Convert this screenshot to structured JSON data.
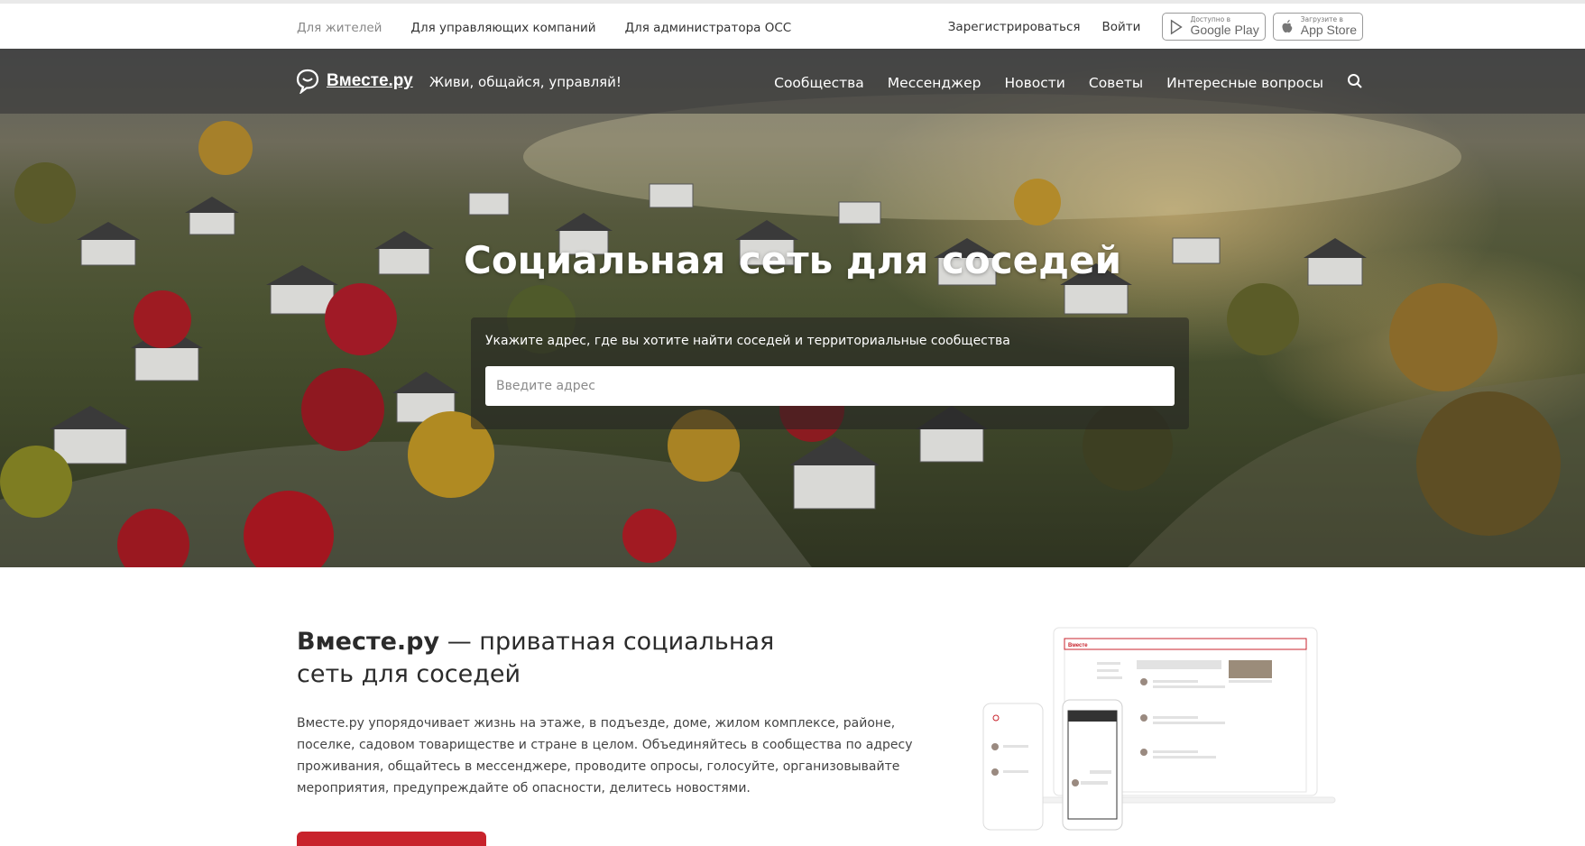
{
  "topbar": {
    "links": [
      "Для жителей",
      "Для управляющих компаний",
      "Для администратора ОСС"
    ],
    "register": "Зарегистрироваться",
    "login": "Войти",
    "google_play": {
      "small": "Доступно в",
      "big": "Google Play"
    },
    "app_store": {
      "small": "Загрузите в",
      "big": "App Store"
    }
  },
  "header": {
    "logo": "Вместе.ру",
    "slogan": "Живи, общайся, управляй!",
    "nav": [
      "Сообщества",
      "Мессенджер",
      "Новости",
      "Советы",
      "Интересные вопросы"
    ]
  },
  "hero": {
    "title": "Социальная сеть для соседей",
    "hint": "Укажите адрес, где вы хотите найти соседей и территориальные сообщества",
    "placeholder": "Введите адрес"
  },
  "about": {
    "title_bold": "Вместе.ру",
    "title_rest": " — приватная социальная сеть для соседей",
    "text": "Вместе.ру упорядочивает жизнь на этаже, в подъезде, доме, жилом комплексе, районе, поселке, садовом товариществе и стране в целом. Объединяйтесь в сообщества по адресу проживания, общайтесь в мессенджере, проводите опросы, голосуйте, организовывайте мероприятия, предупреждайте об опасности, делитесь новостями.",
    "mockup_logo": "Вместе"
  },
  "colors": {
    "accent": "#c8232c",
    "navbar": "#3c3c3c"
  }
}
